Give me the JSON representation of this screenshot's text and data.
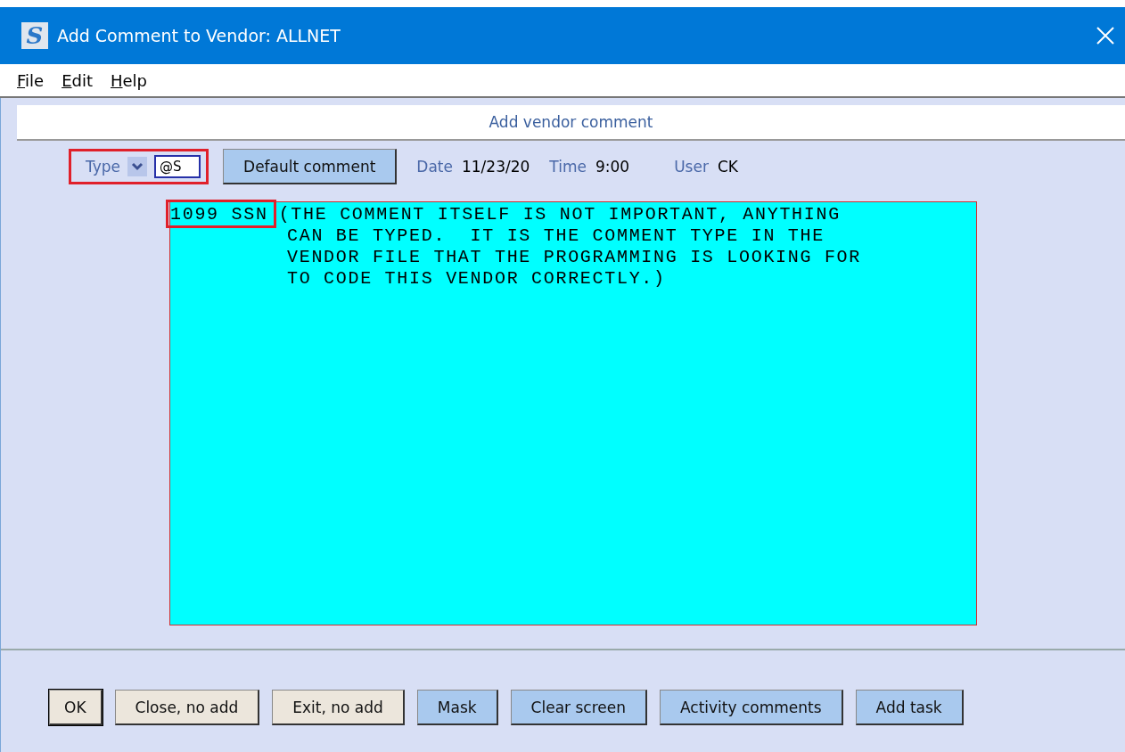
{
  "window": {
    "title": "Add Comment to Vendor:  ALLNET",
    "app_icon_letter": "S"
  },
  "menu": [
    {
      "label": "File"
    },
    {
      "label": "Edit"
    },
    {
      "label": "Help"
    }
  ],
  "section_title": "Add vendor comment",
  "form": {
    "type_label": "Type",
    "type_value": "@S",
    "default_button": "Default comment",
    "date_label": "Date",
    "date_value": "11/23/20",
    "time_label": "Time",
    "time_value": "9:00",
    "user_label": "User",
    "user_value": "CK"
  },
  "comment": {
    "type_tag": "1099 SSN",
    "lines": [
      "(THE COMMENT ITSELF IS NOT IMPORTANT, ANYTHING",
      "CAN BE TYPED.  IT IS THE COMMENT TYPE IN THE",
      "VENDOR FILE THAT THE PROGRAMMING IS LOOKING FOR",
      "TO CODE THIS VENDOR CORRECTLY.)"
    ]
  },
  "buttons": [
    {
      "label": "OK",
      "kind": "plain"
    },
    {
      "label": "Close, no add",
      "kind": "plain"
    },
    {
      "label": "Exit, no add",
      "kind": "plain"
    },
    {
      "label": "Mask",
      "kind": "accent"
    },
    {
      "label": "Clear screen",
      "kind": "accent"
    },
    {
      "label": "Activity comments",
      "kind": "accent"
    },
    {
      "label": "Add task",
      "kind": "accent"
    }
  ]
}
